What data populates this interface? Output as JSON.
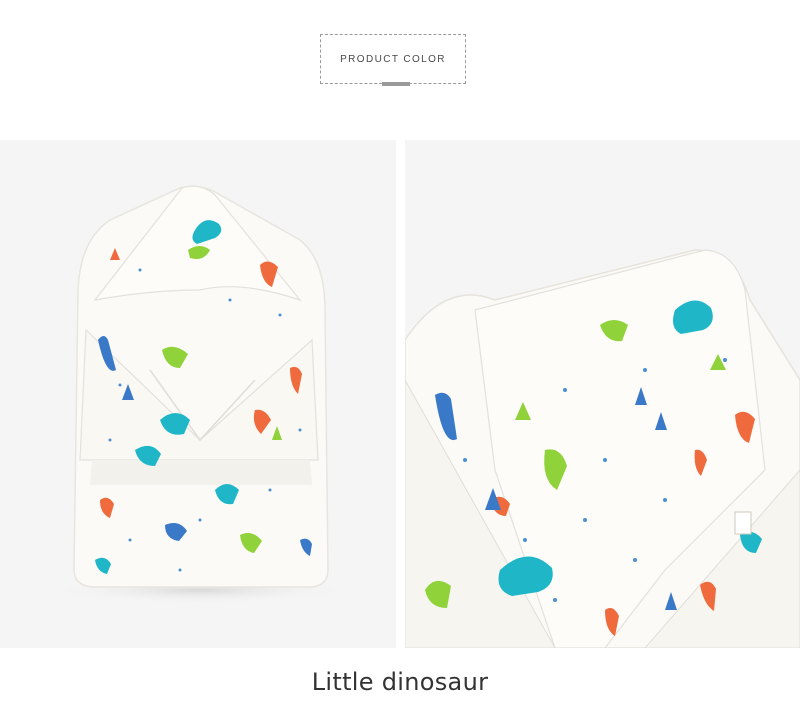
{
  "section": {
    "heading": "PRODUCT COLOR"
  },
  "images": {
    "left": "hooded-swaddle-blanket-front-view",
    "right": "hooded-swaddle-blanket-close-up"
  },
  "caption": "Little dinosaur",
  "colors": {
    "background": "#ffffff",
    "photo_background": "#f5f5f5",
    "blanket": "#fbfaf6",
    "dino_blue": "#3a78c8",
    "dino_teal": "#1fb6c8",
    "dino_green": "#8fd23a",
    "dino_orange": "#ef6b3d",
    "text": "#333333"
  }
}
